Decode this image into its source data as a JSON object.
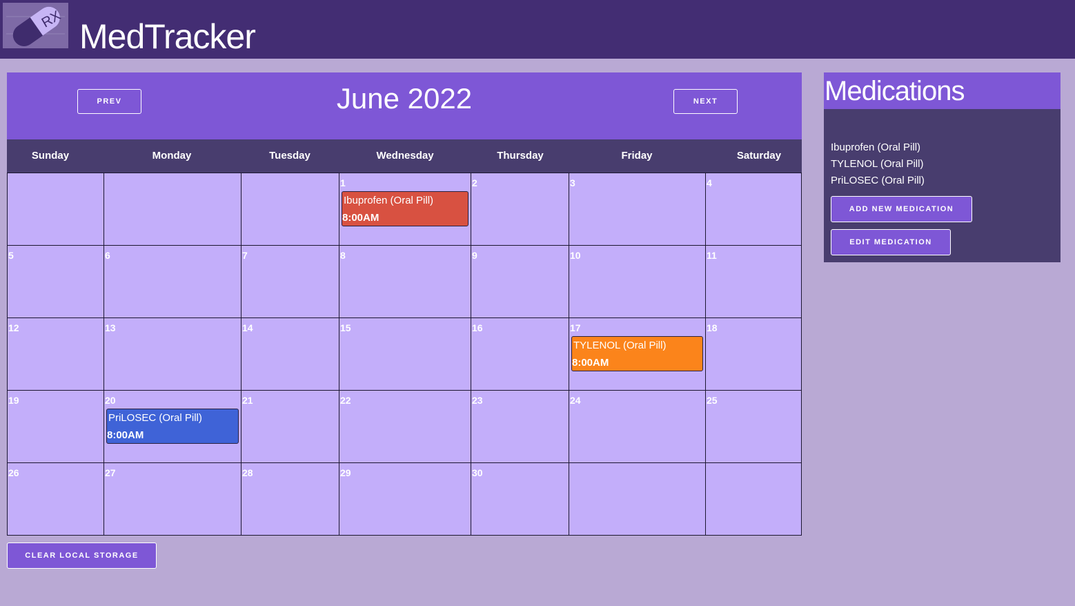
{
  "header": {
    "app_title": "MedTracker",
    "logo_text": "RX"
  },
  "calendar": {
    "month_title": "June 2022",
    "prev_label": "PREV",
    "next_label": "NEXT",
    "weekdays": [
      "Sunday",
      "Monday",
      "Tuesday",
      "Wednesday",
      "Thursday",
      "Friday",
      "Saturday"
    ],
    "weeks": [
      [
        "",
        "",
        "",
        "1",
        "2",
        "3",
        "4"
      ],
      [
        "5",
        "6",
        "7",
        "8",
        "9",
        "10",
        "11"
      ],
      [
        "12",
        "13",
        "14",
        "15",
        "16",
        "17",
        "18"
      ],
      [
        "19",
        "20",
        "21",
        "22",
        "23",
        "24",
        "25"
      ],
      [
        "26",
        "27",
        "28",
        "29",
        "30",
        "",
        ""
      ]
    ],
    "events": [
      {
        "day": "1",
        "name": "Ibuprofen (Oral Pill)",
        "time": "8:00AM",
        "color": "#d85141"
      },
      {
        "day": "17",
        "name": "TYLENOL (Oral Pill)",
        "time": "8:00AM",
        "color": "#fb841b"
      },
      {
        "day": "20",
        "name": "PriLOSEC (Oral Pill)",
        "time": "8:00AM",
        "color": "#3f63d7"
      }
    ]
  },
  "footer": {
    "clear_label": "CLEAR LOCAL STORAGE"
  },
  "medications": {
    "title": "Medications",
    "items": [
      "Ibuprofen (Oral Pill)",
      "TYLENOL (Oral Pill)",
      "PriLOSEC (Oral Pill)"
    ],
    "add_label": "ADD NEW MEDICATION",
    "edit_label": "EDIT MEDICATION"
  },
  "colors": {
    "topbar": "#432d73",
    "accent": "#7e57d6",
    "cell_bg": "#c3aefa",
    "panel_bg": "#483d6e",
    "page_bg": "#b9a9d4"
  }
}
